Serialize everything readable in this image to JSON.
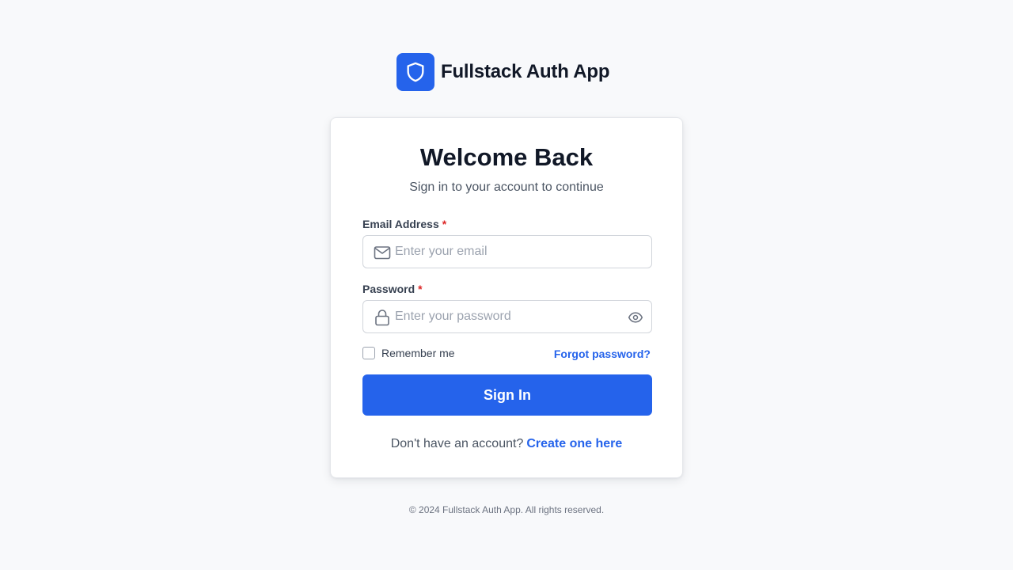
{
  "brand": {
    "name": "Fullstack Auth App",
    "logo_icon": "shield-icon",
    "accent_color": "#2563eb"
  },
  "login": {
    "title": "Welcome Back",
    "subtitle": "Sign in to your account to continue",
    "email": {
      "label": "Email Address",
      "required_mark": "*",
      "placeholder": "Enter your email",
      "value": "",
      "icon": "mail-icon"
    },
    "password": {
      "label": "Password",
      "required_mark": "*",
      "placeholder": "Enter your password",
      "value": "",
      "icon": "lock-icon",
      "toggle_icon": "eye-icon"
    },
    "remember_label": "Remember me",
    "remember_checked": false,
    "forgot_label": "Forgot password?",
    "submit_label": "Sign In",
    "signup_prompt": "Don't have an account?",
    "signup_link": "Create one here"
  },
  "footer": {
    "copyright": "© 2024 Fullstack Auth App. All rights reserved."
  }
}
